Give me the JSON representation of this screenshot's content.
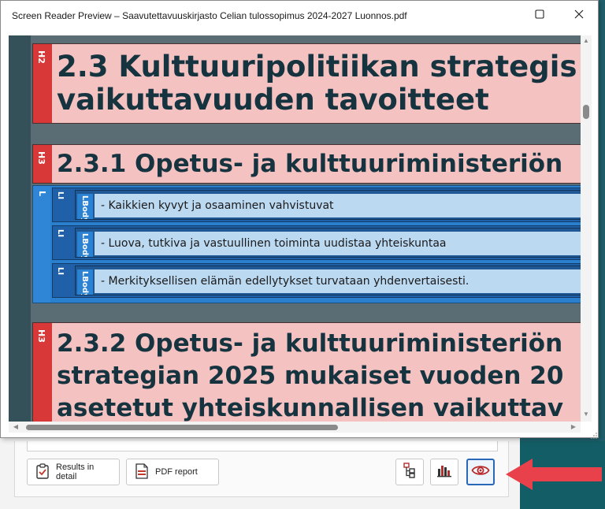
{
  "window": {
    "title": "Screen Reader Preview – Saavutettavuuskirjasto Celian tulossopimus 2024-2027 Luonnos.pdf"
  },
  "content": {
    "h2": {
      "tag": "H2",
      "lines": [
        "2.3 Kulttuuripolitiikan strategis",
        "vaikuttavuuden tavoitteet"
      ]
    },
    "h3a": {
      "tag": "H3",
      "lines": [
        "2.3.1 Opetus- ja kulttuuriministeriön"
      ]
    },
    "list": {
      "tag": "L",
      "items": [
        {
          "li_tag": "LI",
          "lbody_tag": "LBody",
          "text": "- Kaikkien kyvyt ja osaaminen vahvistuvat"
        },
        {
          "li_tag": "LI",
          "lbody_tag": "LBody",
          "text": "- Luova, tutkiva ja vastuullinen toiminta uudistaa yhteiskuntaa"
        },
        {
          "li_tag": "LI",
          "lbody_tag": "LBody",
          "text": "- Merkityksellisen elämän edellytykset turvataan yhdenvertaisesti."
        }
      ]
    },
    "h3b": {
      "tag": "H3",
      "lines": [
        "2.3.2 Opetus- ja kulttuuriministeriön",
        "strategian 2025 mukaiset vuoden 20",
        "asetetut yhteiskunnallisen vaikuttav"
      ]
    }
  },
  "toolbar": {
    "results_label": "Results in detail",
    "pdf_label": "PDF report"
  },
  "colors": {
    "heading_bg": "#f5c2c2",
    "heading_tag": "#d93838",
    "list_blue": "#2a7fcf",
    "text_bg": "#bcd9f2",
    "arrow_red": "#e8414b"
  }
}
